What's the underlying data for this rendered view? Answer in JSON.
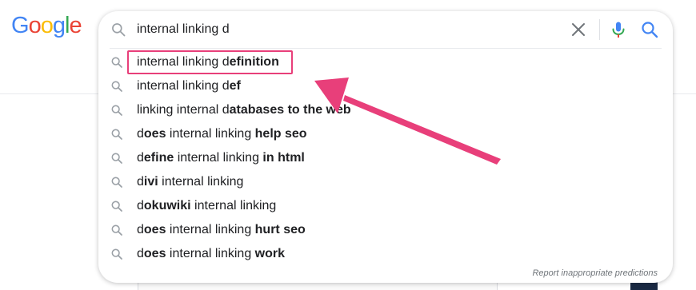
{
  "logo": {
    "letters": [
      {
        "ch": "G",
        "color": "#4285F4"
      },
      {
        "ch": "o",
        "color": "#EA4335"
      },
      {
        "ch": "o",
        "color": "#FBBC05"
      },
      {
        "ch": "g",
        "color": "#4285F4"
      },
      {
        "ch": "l",
        "color": "#34A853"
      },
      {
        "ch": "e",
        "color": "#EA4335"
      }
    ]
  },
  "search": {
    "query": "internal linking d",
    "icons": {
      "search": "search-icon",
      "clear": "close-icon",
      "mic": "microphone-icon",
      "submit": "search-icon"
    }
  },
  "suggestions": [
    {
      "parts": [
        {
          "t": "internal linking d",
          "b": false
        },
        {
          "t": "efinition",
          "b": true
        }
      ]
    },
    {
      "parts": [
        {
          "t": "internal linking d",
          "b": false
        },
        {
          "t": "ef",
          "b": true
        }
      ]
    },
    {
      "parts": [
        {
          "t": "linking internal d",
          "b": false
        },
        {
          "t": "atabases to the web",
          "b": true
        }
      ]
    },
    {
      "parts": [
        {
          "t": "d",
          "b": false
        },
        {
          "t": "oes",
          "b": true
        },
        {
          "t": " internal linking ",
          "b": false
        },
        {
          "t": "help seo",
          "b": true
        }
      ]
    },
    {
      "parts": [
        {
          "t": "d",
          "b": false
        },
        {
          "t": "efine",
          "b": true
        },
        {
          "t": " internal linking ",
          "b": false
        },
        {
          "t": "in html",
          "b": true
        }
      ]
    },
    {
      "parts": [
        {
          "t": "d",
          "b": false
        },
        {
          "t": "ivi",
          "b": true
        },
        {
          "t": " internal linking",
          "b": false
        }
      ]
    },
    {
      "parts": [
        {
          "t": "d",
          "b": false
        },
        {
          "t": "okuwiki",
          "b": true
        },
        {
          "t": " internal linking",
          "b": false
        }
      ]
    },
    {
      "parts": [
        {
          "t": "d",
          "b": false
        },
        {
          "t": "oes",
          "b": true
        },
        {
          "t": " internal linking ",
          "b": false
        },
        {
          "t": "hurt seo",
          "b": true
        }
      ]
    },
    {
      "parts": [
        {
          "t": "d",
          "b": false
        },
        {
          "t": "oes",
          "b": true
        },
        {
          "t": " internal linking ",
          "b": false
        },
        {
          "t": "work",
          "b": true
        }
      ]
    }
  ],
  "report_link": "Report inappropriate predictions",
  "colors": {
    "annotation": "#E83F7A",
    "icon_gray": "#9aa0a6",
    "google_blue": "#4285F4"
  }
}
